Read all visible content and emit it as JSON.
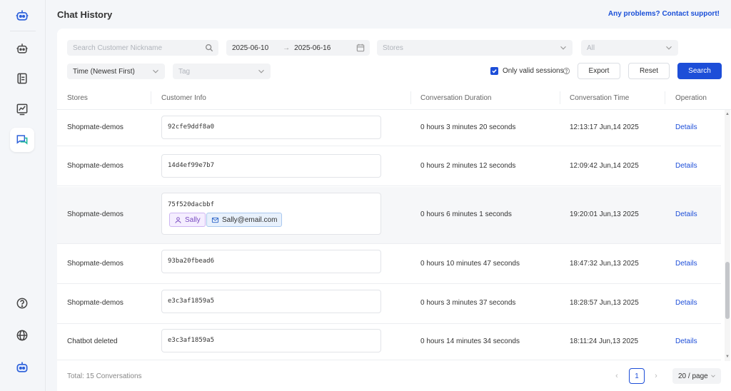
{
  "header": {
    "title": "Chat History",
    "support_link": "Any problems? Contact support!"
  },
  "sidebar": {
    "items": [
      {
        "icon": "robot-logo-icon"
      },
      {
        "icon": "bot-settings-icon"
      },
      {
        "icon": "knowledge-book-icon"
      },
      {
        "icon": "analytics-chart-icon"
      },
      {
        "icon": "chat-history-icon",
        "active": true
      },
      {
        "icon": "help-icon"
      },
      {
        "icon": "language-globe-icon"
      },
      {
        "icon": "avatar-bot-icon"
      }
    ]
  },
  "filters": {
    "search_placeholder": "Search Customer Nickname",
    "date_start": "2025-06-10",
    "date_arrow": "→",
    "date_end": "2025-06-16",
    "stores_placeholder": "Stores",
    "status_placeholder": "All",
    "sort_value": "Time (Newest First)",
    "tag_placeholder": "Tag",
    "valid_sessions_label": "Only valid sessions",
    "valid_sessions_checked": true,
    "export_label": "Export",
    "reset_label": "Reset",
    "search_label": "Search"
  },
  "table": {
    "columns": [
      "Stores",
      "Customer Info",
      "Conversation Duration",
      "Conversation Time",
      "Operation"
    ],
    "rows": [
      {
        "store": "Shopmate-demos",
        "customer_id": "92cfe9ddf8a0",
        "duration": "0 hours 3 minutes 20 seconds",
        "time": "12:13:17 Jun,14 2025",
        "operation": "Details"
      },
      {
        "store": "Shopmate-demos",
        "customer_id": "14d4ef99e7b7",
        "duration": "0 hours 2 minutes 12 seconds",
        "time": "12:09:42 Jun,14 2025",
        "operation": "Details"
      },
      {
        "store": "Shopmate-demos",
        "customer_id": "75f520dacbbf",
        "name_tag": "Sally",
        "email_tag": "Sally@email.com",
        "duration": "0 hours 6 minutes 1 seconds",
        "time": "19:20:01 Jun,13 2025",
        "operation": "Details"
      },
      {
        "store": "Shopmate-demos",
        "customer_id": "93ba20fbead6",
        "duration": "0 hours 10 minutes 47 seconds",
        "time": "18:47:32 Jun,13 2025",
        "operation": "Details"
      },
      {
        "store": "Shopmate-demos",
        "customer_id": "e3c3af1859a5",
        "duration": "0 hours 3 minutes 37 seconds",
        "time": "18:28:57 Jun,13 2025",
        "operation": "Details"
      },
      {
        "store": "Chatbot deleted",
        "customer_id": "e3c3af1859a5",
        "duration": "0 hours 14 minutes 34 seconds",
        "time": "18:11:24 Jun,13 2025",
        "operation": "Details"
      }
    ]
  },
  "footer": {
    "total": "Total: 15 Conversations",
    "current_page": "1",
    "page_size": "20 / page",
    "prev": "‹",
    "next": "›"
  },
  "colors": {
    "accent": "#1d4ed8",
    "name_tag_bg": "#f5eeff",
    "email_tag_bg": "#e8f1fc"
  }
}
